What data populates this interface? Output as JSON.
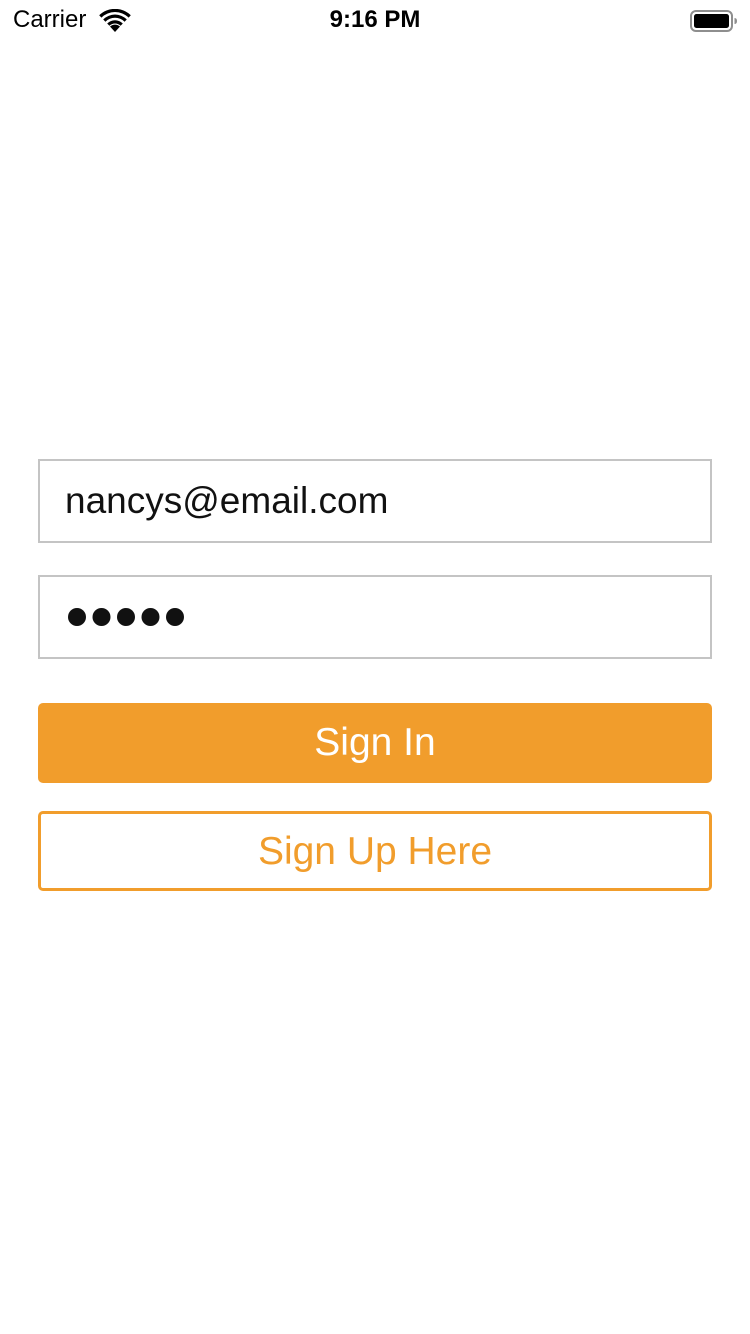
{
  "status_bar": {
    "carrier": "Carrier",
    "time": "9:16 PM",
    "wifi_icon": "wifi-icon",
    "battery_icon": "battery-icon"
  },
  "login_form": {
    "email_value": "nancys@email.com",
    "password_masked": "•••••",
    "password_length": 5,
    "sign_in_label": "Sign In",
    "sign_up_label": "Sign Up Here"
  },
  "colors": {
    "accent": "#f19d2c",
    "field_border": "#c4c4c4",
    "text": "#111111",
    "background": "#ffffff"
  }
}
